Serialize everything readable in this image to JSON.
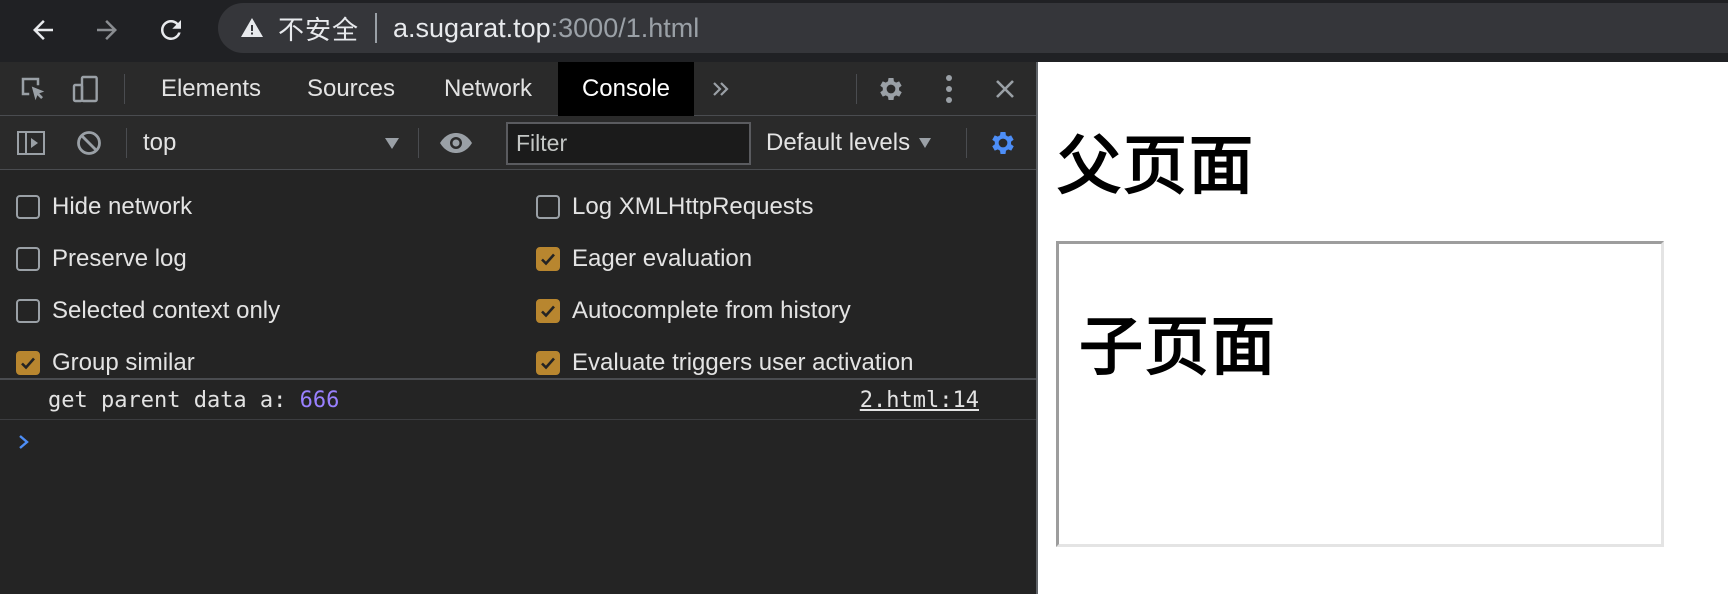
{
  "browser": {
    "security_label": "不安全",
    "url_host": "a.sugarat.top",
    "url_rest": ":3000/1.html"
  },
  "devtools": {
    "tabs": [
      {
        "label": "Elements",
        "active": false
      },
      {
        "label": "Sources",
        "active": false
      },
      {
        "label": "Network",
        "active": false
      },
      {
        "label": "Console",
        "active": true
      }
    ],
    "toolbar": {
      "context": "top",
      "filter_placeholder": "Filter",
      "levels": "Default levels"
    },
    "settings_left": [
      {
        "label": "Hide network",
        "checked": false
      },
      {
        "label": "Preserve log",
        "checked": false
      },
      {
        "label": "Selected context only",
        "checked": false
      },
      {
        "label": "Group similar",
        "checked": true
      }
    ],
    "settings_right": [
      {
        "label": "Log XMLHttpRequests",
        "checked": false
      },
      {
        "label": "Eager evaluation",
        "checked": true
      },
      {
        "label": "Autocomplete from history",
        "checked": true
      },
      {
        "label": "Evaluate triggers user activation",
        "checked": true
      }
    ],
    "console": {
      "message": "get parent data a: ",
      "value": "666",
      "source": "2.html:14"
    },
    "colors": {
      "checkbox_checked": "#b8862f",
      "settings_icon": "#4d8ef7",
      "number_value": "#9980ff"
    }
  },
  "page": {
    "parent_title": "父页面",
    "child_title": "子页面"
  }
}
